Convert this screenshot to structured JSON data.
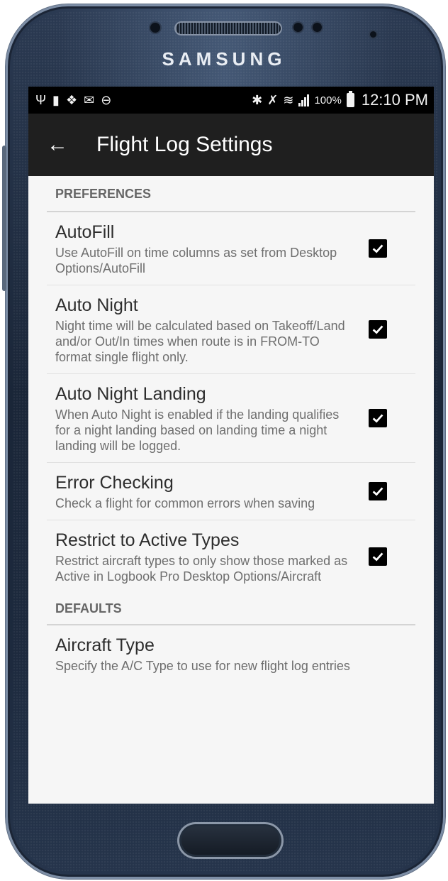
{
  "device": {
    "brand": "SAMSUNG"
  },
  "status_bar": {
    "icons_left": [
      "usb-icon",
      "sd-card-icon",
      "dropbox-icon",
      "mail-icon",
      "do-not-disturb-icon"
    ],
    "icons_right": [
      "bluetooth-icon",
      "mute-icon",
      "wifi-icon",
      "signal-icon",
      "battery-icon"
    ],
    "battery": "100%",
    "time": "12:10 PM"
  },
  "app_bar": {
    "title": "Flight Log Settings",
    "back_icon": "arrow-left-icon"
  },
  "sections": [
    {
      "header": "PREFERENCES",
      "items": [
        {
          "title": "AutoFill",
          "summary": "Use AutoFill on time columns as set from Desktop Options/AutoFill",
          "checked": true
        },
        {
          "title": "Auto Night",
          "summary": "Night time will be calculated based on Takeoff/Land and/or Out/In times when route is in FROM-TO format single flight only.",
          "checked": true
        },
        {
          "title": "Auto Night Landing",
          "summary": "When Auto Night is enabled if the landing qualifies for a night landing based on landing time a night landing will be logged.",
          "checked": true
        },
        {
          "title": "Error Checking",
          "summary": "Check a flight for common errors when saving",
          "checked": true
        },
        {
          "title": "Restrict to Active Types",
          "summary": "Restrict aircraft types to only show those marked as Active in Logbook Pro Desktop Options/Aircraft",
          "checked": true
        }
      ]
    },
    {
      "header": "DEFAULTS",
      "items": [
        {
          "title": "Aircraft Type",
          "summary": "Specify the A/C Type to use for new flight log entries"
        }
      ]
    }
  ]
}
